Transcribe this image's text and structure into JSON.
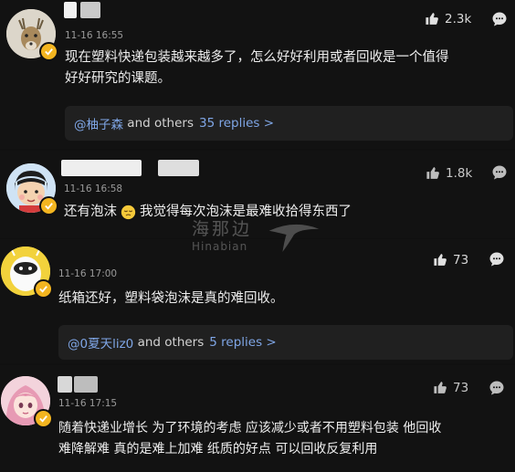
{
  "comments": [
    {
      "avatar_icon": "deer-avatar-icon",
      "time": "11-16 16:55",
      "likes": "2.3k",
      "text_line1": "现在塑料快递包装越来越多了，怎么好好利用或者回收是一个值得",
      "text_line2": "好好研究的课题。",
      "replies_user": "@柚子森",
      "replies_and": "and others",
      "replies_count": "35 replies >"
    },
    {
      "avatar_icon": "cartoon-girl-avatar-icon",
      "time": "11-16 16:58",
      "likes": "1.8k",
      "text_before": "还有泡沫",
      "emoji": "sleepy-face-emoji",
      "text_after": "我觉得每次泡沫是最难收拾得东西了"
    },
    {
      "avatar_icon": "white-robot-avatar-icon",
      "time": "11-16 17:00",
      "likes": "73",
      "text_line1": "纸箱还好，塑料袋泡沫是真的难回收。",
      "replies_user": "@0夏天liz0",
      "replies_and": "and others",
      "replies_count": "5 replies >"
    },
    {
      "avatar_icon": "anime-girl-avatar-icon",
      "time": "11-16 17:15",
      "likes": "73",
      "text_line1": "随着快递业增长 为了环境的考虑 应该减少或者不用塑料包装 他回收",
      "text_line2": "难降解难 真的是难上加难 纸质的好点 可以回收反复利用"
    }
  ],
  "watermark": {
    "cn": "海那边",
    "en": "Hinabian"
  },
  "colors": {
    "background": "#101010",
    "badge": "#f3b520",
    "link": "#7fa6e6",
    "reply_box": "#202020"
  }
}
